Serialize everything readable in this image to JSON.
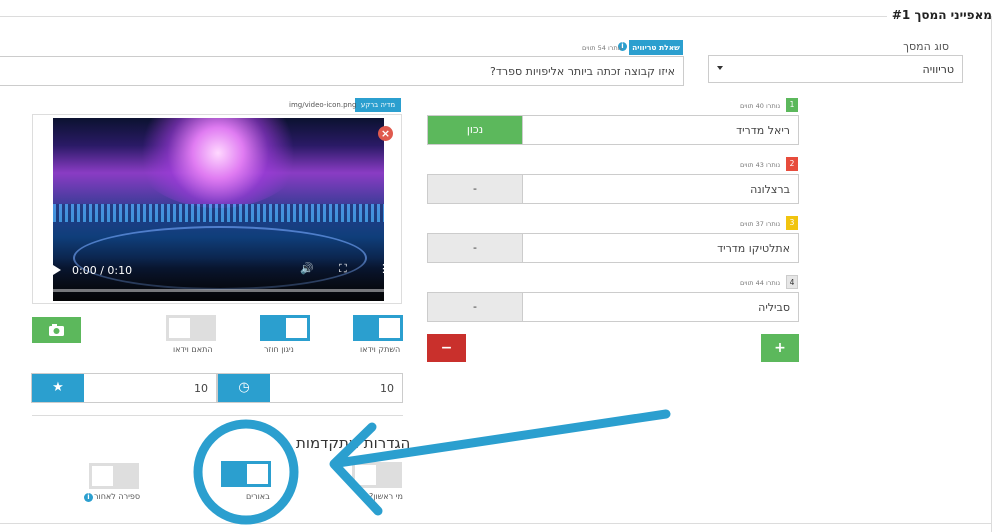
{
  "section": {
    "title": "מאפייני המסך #1"
  },
  "screen_type": {
    "label": "סוג המסך",
    "value": "טריוויה"
  },
  "question": {
    "badge": "שאלת טריוויה",
    "hint": "נותרו 54 תווים",
    "text": "איזו קבוצה זכתה ביותר אליפויות ספרד?"
  },
  "media": {
    "badge": "מדיה ברקע",
    "path": "img/video-icon.png",
    "time": "0:00 / 0:10"
  },
  "answers": [
    {
      "number": "1",
      "hint": "נותרו 40 תווים",
      "text": "ריאל מדריד",
      "state": "נכון",
      "color": "#5cb85c"
    },
    {
      "number": "2",
      "hint": "נותרו 43 תווים",
      "text": "ברצלונה",
      "state": "-",
      "color": "#e74c3c"
    },
    {
      "number": "3",
      "hint": "נותרו 37 תווים",
      "text": "אתלטיקו מדריד",
      "state": "-",
      "color": "#f1c40f"
    },
    {
      "number": "4",
      "hint": "נותרו 44 תווים",
      "text": "סביליה",
      "state": "-",
      "color": "#dddddd"
    }
  ],
  "buttons": {
    "add": "+",
    "remove": "−"
  },
  "toggles": {
    "mute_video": {
      "label": "השתק וידאו",
      "on": true
    },
    "autoplay": {
      "label": "ניגון חוזר",
      "on": true
    },
    "sync_video": {
      "label": "התאם וידאו",
      "on": false
    }
  },
  "timer_fields": {
    "time": "10",
    "points": "10"
  },
  "advanced": {
    "title": "הגדרות מתקדמות",
    "first_label": "מי ראשון?",
    "lights_label": "באורים",
    "lights_on": true,
    "countdown_label": "ספירה לאחור",
    "countdown_on": false
  },
  "colors": {
    "accent": "#2b9fcf",
    "success": "#5cb85c",
    "danger": "#c9302c"
  }
}
